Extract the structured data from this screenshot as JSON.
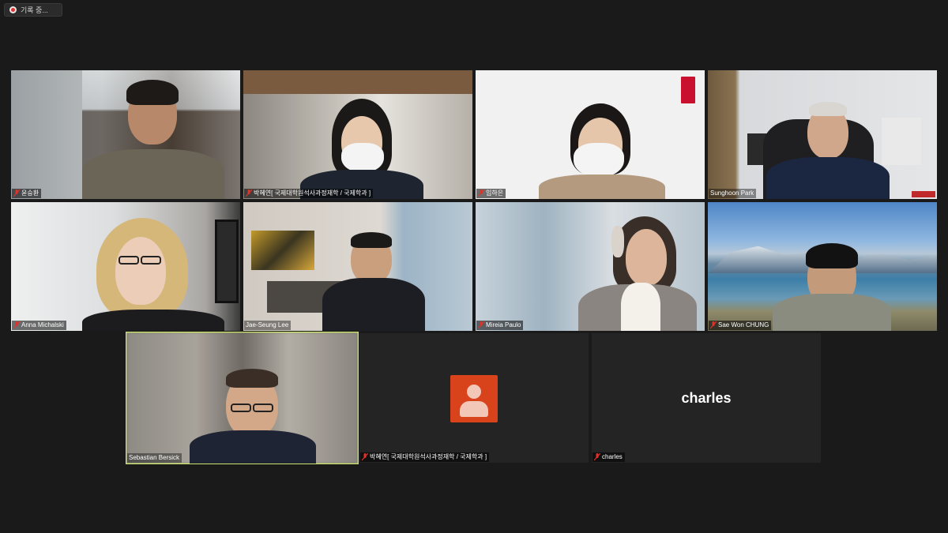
{
  "recording": {
    "label": "기록 중..."
  },
  "participants": [
    {
      "name": "윤승환"
    },
    {
      "name": "박혜연[ 국제대학원석사과정재학 / 국제학과 ]"
    },
    {
      "name": "임하은"
    },
    {
      "name": "Sunghoon Park"
    },
    {
      "name": "Anna Michalski"
    },
    {
      "name": "Jae-Seung Lee"
    },
    {
      "name": "Mireia Paulo"
    },
    {
      "name": "Sae Won CHUNG"
    },
    {
      "name": "Sebastian Bersick"
    },
    {
      "name": "박혜연[ 국제대학원석사과정재학 / 국제학과 ]"
    },
    {
      "name": "charles",
      "display_name": "charles"
    }
  ],
  "colors": {
    "active_speaker_border": "#c6e06a",
    "mic_muted": "#e0322a",
    "avatar_bg": "#d9431c"
  }
}
